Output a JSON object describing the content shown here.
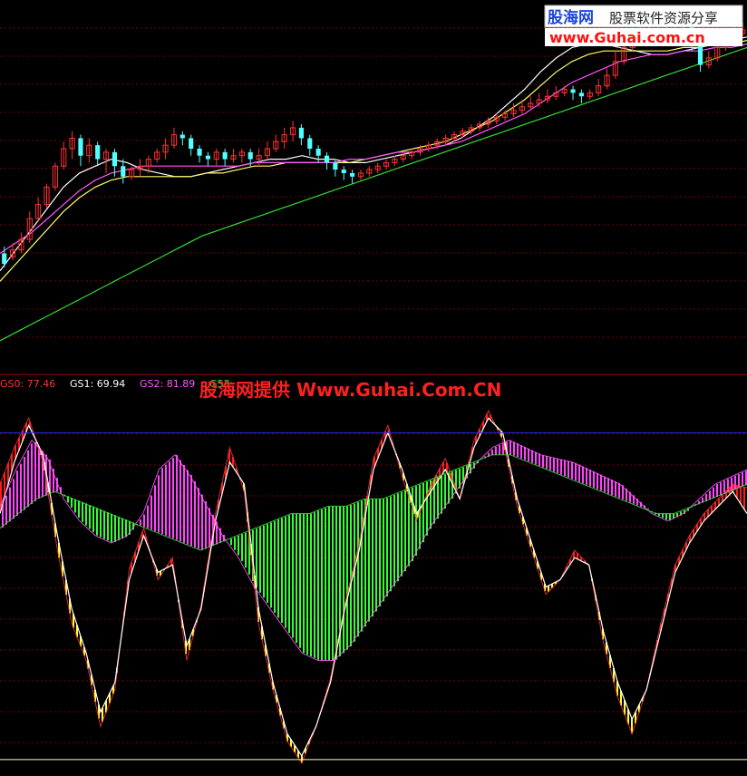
{
  "watermark": {
    "logo_text": "股海网",
    "slogan": "股票软件资源分享",
    "url": "www.Guhai.com.cn",
    "overlay": "股海网提供 Www.Guhai.Com.CN"
  },
  "colors": {
    "bull_candle": "#ff3232",
    "bear_candle": "#54ffff",
    "ma_short": "#ffffff",
    "ma_mid": "#ffff66",
    "ma_long": "#ff55ff",
    "ma_longest": "#33dd33",
    "gs0": "#ff3232",
    "gs1": "#ffffff",
    "gs2": "#ff55ff",
    "gs3": "#33dd33",
    "hist_red": "#ff1a1a",
    "hist_yellow": "#ffff33",
    "hist_magenta": "#ff44ff",
    "hist_green": "#33ff33",
    "upper_line": "#2a2aff",
    "lower_line": "#ffffcc",
    "grid": "#7a0000"
  },
  "indicator_legend": [
    {
      "name": "GS0",
      "value": "77.46",
      "color": "#ff3232"
    },
    {
      "name": "GS1",
      "value": "69.94",
      "color": "#ffffff"
    },
    {
      "name": "GS2",
      "value": "81.89",
      "color": "#ff55ff"
    },
    {
      "name": "GS3",
      "value": "",
      "color": "#33dd33"
    }
  ],
  "chart_data": [
    {
      "type": "candlestick",
      "title": "",
      "ylim": [
        0,
        100
      ],
      "xlim": [
        0,
        160
      ],
      "grid": true,
      "candles_ohlc": [
        [
          30,
          27,
          32,
          26
        ],
        [
          29,
          31,
          33,
          28
        ],
        [
          31,
          34,
          36,
          30
        ],
        [
          34,
          40,
          42,
          33
        ],
        [
          40,
          44,
          46,
          39
        ],
        [
          44,
          49,
          50,
          43
        ],
        [
          49,
          55,
          56,
          48
        ],
        [
          55,
          60,
          62,
          54
        ],
        [
          60,
          63,
          65,
          57
        ],
        [
          63,
          58,
          64,
          55
        ],
        [
          58,
          61,
          63,
          56
        ],
        [
          61,
          57,
          62,
          55
        ],
        [
          57,
          59,
          60,
          53
        ],
        [
          59,
          55,
          60,
          52
        ],
        [
          55,
          52,
          57,
          50
        ],
        [
          52,
          54,
          55,
          51
        ],
        [
          54,
          55,
          57,
          52
        ],
        [
          55,
          57,
          58,
          53
        ],
        [
          57,
          59,
          60,
          56
        ],
        [
          59,
          61,
          63,
          57
        ],
        [
          61,
          64,
          66,
          60
        ],
        [
          64,
          63,
          65,
          61
        ],
        [
          63,
          60,
          64,
          58
        ],
        [
          60,
          58,
          61,
          56
        ],
        [
          58,
          57,
          59,
          55
        ],
        [
          57,
          59,
          60,
          55
        ],
        [
          59,
          57,
          60,
          55
        ],
        [
          57,
          58,
          60,
          56
        ],
        [
          58,
          59,
          60,
          56
        ],
        [
          59,
          57,
          60,
          55
        ],
        [
          57,
          58,
          60,
          55
        ],
        [
          58,
          60,
          62,
          57
        ],
        [
          60,
          62,
          64,
          59
        ],
        [
          62,
          64,
          66,
          60
        ],
        [
          64,
          66,
          68,
          62
        ],
        [
          66,
          63,
          67,
          61
        ],
        [
          63,
          60,
          64,
          58
        ],
        [
          60,
          58,
          61,
          56
        ],
        [
          58,
          56,
          59,
          54
        ],
        [
          56,
          54,
          57,
          52
        ],
        [
          54,
          53,
          55,
          51
        ],
        [
          53,
          52,
          54,
          50
        ],
        [
          52,
          53,
          54,
          51
        ],
        [
          53,
          54,
          55,
          52
        ],
        [
          54,
          55,
          56,
          53
        ],
        [
          55,
          56,
          57,
          54
        ],
        [
          56,
          57,
          58,
          55
        ],
        [
          57,
          58,
          59,
          56
        ],
        [
          58,
          59,
          60,
          57
        ],
        [
          59,
          60,
          61,
          58
        ],
        [
          60,
          61,
          62,
          59
        ],
        [
          61,
          62,
          63,
          60
        ],
        [
          62,
          63,
          64,
          61
        ],
        [
          63,
          64,
          65,
          62
        ],
        [
          64,
          65,
          66,
          63
        ],
        [
          65,
          66,
          67,
          64
        ],
        [
          66,
          67,
          68,
          65
        ],
        [
          67,
          68,
          69,
          66
        ],
        [
          68,
          69,
          70,
          67
        ],
        [
          69,
          70,
          71,
          68
        ],
        [
          70,
          71,
          73,
          69
        ],
        [
          71,
          72,
          74,
          70
        ],
        [
          72,
          73,
          75,
          71
        ],
        [
          73,
          74,
          76,
          72
        ],
        [
          74,
          75,
          77,
          73
        ],
        [
          75,
          76,
          78,
          74
        ],
        [
          76,
          77,
          78,
          75
        ],
        [
          77,
          76,
          78,
          74
        ],
        [
          76,
          75,
          77,
          73
        ],
        [
          75,
          76,
          77,
          74
        ],
        [
          76,
          78,
          80,
          75
        ],
        [
          78,
          81,
          83,
          77
        ],
        [
          81,
          85,
          88,
          80
        ],
        [
          85,
          89,
          92,
          84
        ],
        [
          89,
          94,
          96,
          88
        ],
        [
          94,
          97,
          99,
          92
        ],
        [
          97,
          95,
          98,
          93
        ],
        [
          95,
          96,
          97,
          94
        ],
        [
          96,
          95,
          97,
          93
        ],
        [
          95,
          96,
          97,
          94
        ],
        [
          96,
          95,
          97,
          93
        ],
        [
          95,
          90,
          96,
          88
        ],
        [
          90,
          84,
          91,
          82
        ],
        [
          84,
          86,
          88,
          83
        ],
        [
          86,
          89,
          90,
          85
        ],
        [
          89,
          91,
          93,
          88
        ],
        [
          91,
          93,
          95,
          90
        ],
        [
          93,
          94,
          96,
          92
        ]
      ],
      "series": [
        {
          "name": "",
          "values": [
            25,
            31,
            37,
            43,
            49,
            53,
            55,
            57,
            56,
            54,
            53,
            52,
            52,
            53,
            54,
            55,
            56,
            57,
            57,
            58,
            57,
            57,
            56,
            56,
            57,
            58,
            59,
            60,
            61,
            63,
            66,
            69,
            73,
            77,
            82,
            86,
            89,
            90,
            90,
            89,
            88,
            87,
            87,
            88,
            89,
            90,
            91,
            92
          ]
        },
        {
          "name": "",
          "values": [
            22,
            27,
            32,
            37,
            42,
            46,
            49,
            51,
            52,
            52,
            52,
            52,
            52,
            53,
            53,
            54,
            55,
            55,
            56,
            56,
            56,
            56,
            56,
            57,
            58,
            59,
            60,
            61,
            62,
            64,
            66,
            68,
            71,
            74,
            78,
            82,
            85,
            87,
            88,
            88,
            88,
            88,
            88,
            89,
            89,
            90,
            90,
            91
          ]
        },
        {
          "name": "",
          "values": [
            30,
            33,
            36,
            40,
            44,
            48,
            51,
            53,
            54,
            55,
            55,
            55,
            55,
            55,
            55,
            55,
            56,
            56,
            56,
            56,
            56,
            56,
            57,
            57,
            58,
            59,
            59,
            60,
            61,
            62,
            64,
            66,
            68,
            70,
            73,
            76,
            79,
            81,
            83,
            85,
            86,
            87,
            87,
            88,
            88,
            89,
            89,
            90
          ]
        },
        {
          "name": "",
          "values": [
            5,
            8,
            11,
            14,
            17,
            20,
            23,
            26,
            29,
            32,
            35,
            37,
            39,
            41,
            43,
            45,
            47,
            49,
            51,
            53,
            55,
            57,
            59,
            61,
            63,
            65,
            67,
            69,
            71,
            73,
            75,
            77,
            79,
            81,
            83,
            85,
            87,
            89
          ]
        }
      ]
    },
    {
      "type": "line",
      "title": "",
      "ylim": [
        0,
        100
      ],
      "grid": true,
      "reference_lines": [
        92,
        3
      ],
      "series": [
        {
          "name": "GS0",
          "values": [
            78,
            88,
            96,
            84,
            60,
            40,
            30,
            12,
            22,
            55,
            66,
            52,
            58,
            30,
            45,
            70,
            88,
            76,
            40,
            22,
            8,
            2,
            12,
            25,
            45,
            62,
            85,
            94,
            80,
            68,
            78,
            85,
            74,
            90,
            98,
            90,
            72,
            60,
            48,
            52,
            60,
            56,
            35,
            20,
            10,
            22,
            40,
            56,
            64,
            70,
            74,
            78,
            77
          ]
        },
        {
          "name": "GS1",
          "values": [
            70,
            84,
            94,
            86,
            64,
            44,
            32,
            16,
            24,
            52,
            64,
            54,
            56,
            34,
            44,
            68,
            84,
            78,
            44,
            24,
            10,
            4,
            12,
            24,
            44,
            60,
            82,
            92,
            82,
            70,
            76,
            82,
            74,
            88,
            96,
            92,
            74,
            62,
            50,
            52,
            58,
            56,
            38,
            24,
            14,
            22,
            38,
            54,
            62,
            68,
            72,
            76,
            70
          ]
        },
        {
          "name": "GS2",
          "values": [
            72,
            82,
            90,
            85,
            74,
            68,
            64,
            62,
            64,
            70,
            82,
            86,
            80,
            72,
            64,
            58,
            50,
            44,
            38,
            32,
            30,
            30,
            34,
            40,
            46,
            52,
            58,
            66,
            72,
            78,
            84,
            88,
            90,
            88,
            86,
            85,
            84,
            82,
            80,
            78,
            74,
            70,
            68,
            70,
            74,
            78,
            80,
            82
          ]
        },
        {
          "name": "GS3",
          "values": [
            66,
            70,
            74,
            76,
            74,
            72,
            70,
            68,
            66,
            64,
            62,
            60,
            62,
            64,
            66,
            68,
            70,
            70,
            72,
            72,
            74,
            74,
            76,
            78,
            80,
            82,
            84,
            86,
            86,
            84,
            82,
            80,
            78,
            76,
            74,
            72,
            70,
            70,
            72,
            74,
            76,
            78
          ]
        }
      ]
    }
  ]
}
